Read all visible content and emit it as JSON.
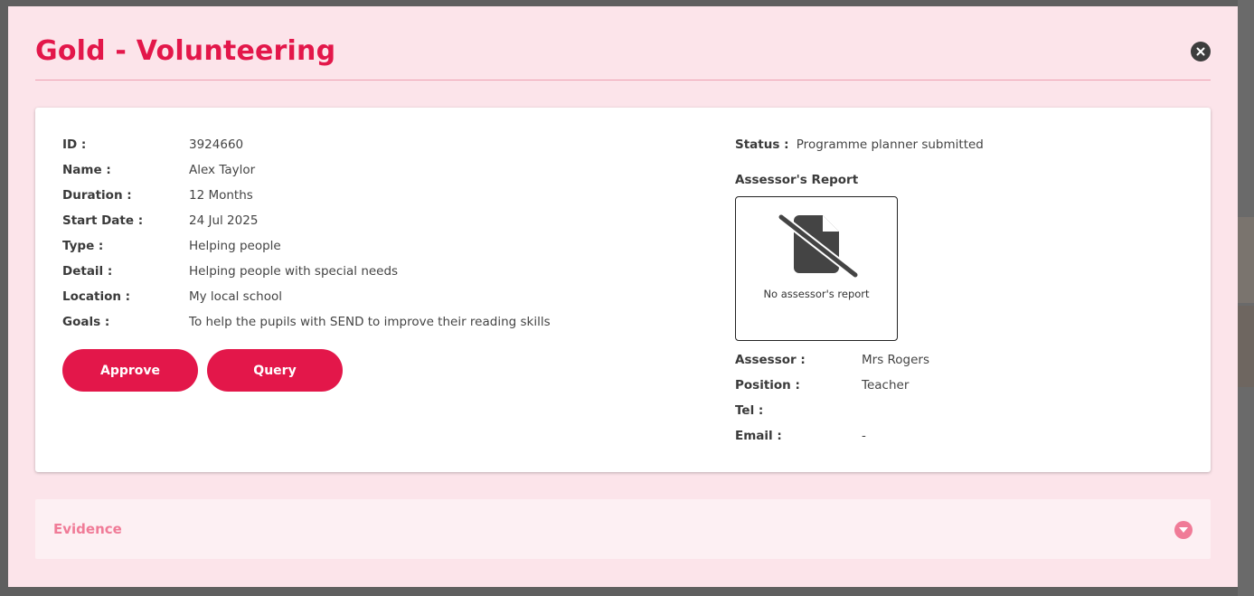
{
  "modal": {
    "title": "Gold - Volunteering",
    "close_icon": "close-icon"
  },
  "details": {
    "fields": [
      {
        "label": "ID :",
        "value": "3924660"
      },
      {
        "label": "Name :",
        "value": "Alex Taylor"
      },
      {
        "label": "Duration :",
        "value": "12 Months"
      },
      {
        "label": "Start Date :",
        "value": "24 Jul 2025"
      },
      {
        "label": "Type :",
        "value": "Helping people"
      },
      {
        "label": "Detail :",
        "value": "Helping people with special needs"
      },
      {
        "label": "Location :",
        "value": "My local school"
      },
      {
        "label": "Goals :",
        "value": "To help the pupils with SEND to improve their reading skills"
      }
    ],
    "approve_label": "Approve",
    "query_label": "Query"
  },
  "status": {
    "label": "Status :",
    "value": "Programme planner submitted"
  },
  "report": {
    "heading": "Assessor's Report",
    "icon": "no-file-icon",
    "caption": "No assessor's report"
  },
  "assessor": {
    "fields": [
      {
        "label": "Assessor :",
        "value": "Mrs Rogers"
      },
      {
        "label": "Position :",
        "value": "Teacher"
      },
      {
        "label": "Tel :",
        "value": ""
      },
      {
        "label": "Email :",
        "value": "-"
      }
    ]
  },
  "evidence": {
    "label": "Evidence",
    "toggle_icon": "chevron-down-icon"
  },
  "colors": {
    "accent": "#e3174a",
    "modal_bg": "#fce4ea",
    "evidence_text": "#f07b97"
  }
}
